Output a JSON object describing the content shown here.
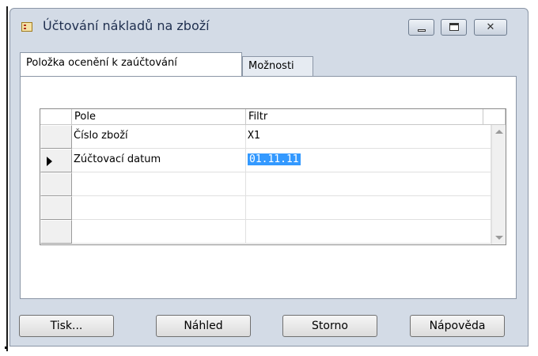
{
  "window": {
    "title": "Účtování nákladů na zboží",
    "controls": {
      "minimize": "",
      "maximize": "",
      "close": "✕"
    }
  },
  "tabs": [
    {
      "label": "Položka ocenění k zaúčtování",
      "active": true
    },
    {
      "label": "Možnosti",
      "active": false
    }
  ],
  "grid": {
    "columns": [
      "Pole",
      "Filtr"
    ],
    "rows": [
      {
        "pole": "Číslo zboží",
        "filtr": "X1",
        "current": false
      },
      {
        "pole": "Zúčtovací datum",
        "filtr": "01.11.11",
        "current": true
      },
      {
        "pole": "",
        "filtr": "",
        "current": false
      },
      {
        "pole": "",
        "filtr": "",
        "current": false
      },
      {
        "pole": "",
        "filtr": "",
        "current": false
      }
    ]
  },
  "buttons": {
    "print": "Tisk...",
    "preview": "Náhled",
    "cancel": "Storno",
    "help": "Nápověda"
  },
  "colors": {
    "window_bg": "#d3dbe6",
    "selection": "#3399ff"
  }
}
